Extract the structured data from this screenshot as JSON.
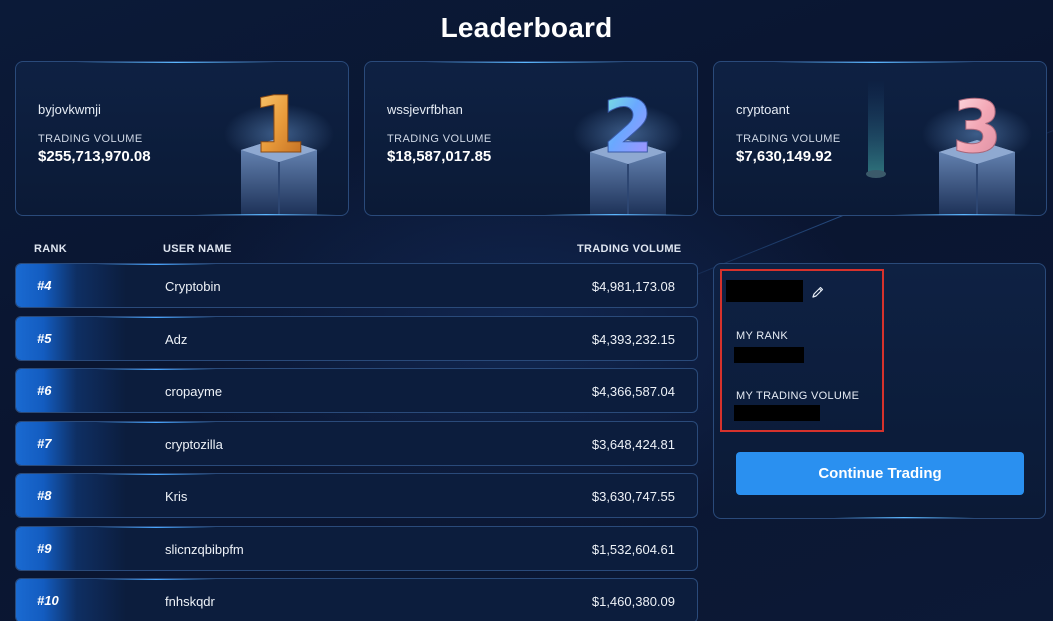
{
  "page_title": "Leaderboard",
  "podium": [
    {
      "rank_glyph": "1",
      "username": "byjovkwmji",
      "volume_label": "TRADING VOLUME",
      "volume": "$255,713,970.08"
    },
    {
      "rank_glyph": "2",
      "username": "wssjevrfbhan",
      "volume_label": "TRADING VOLUME",
      "volume": "$18,587,017.85"
    },
    {
      "rank_glyph": "3",
      "username": "cryptoant",
      "volume_label": "TRADING VOLUME",
      "volume": "$7,630,149.92"
    }
  ],
  "table": {
    "headers": {
      "rank": "RANK",
      "username": "USER NAME",
      "volume": "TRADING VOLUME"
    },
    "rows": [
      {
        "rank": "#4",
        "username": "Cryptobin",
        "volume": "$4,981,173.08"
      },
      {
        "rank": "#5",
        "username": "Adz",
        "volume": "$4,393,232.15"
      },
      {
        "rank": "#6",
        "username": "cropayme",
        "volume": "$4,366,587.04"
      },
      {
        "rank": "#7",
        "username": "cryptozilla",
        "volume": "$3,648,424.81"
      },
      {
        "rank": "#8",
        "username": "Kris",
        "volume": "$3,630,747.55"
      },
      {
        "rank": "#9",
        "username": "slicnzqbibpfm",
        "volume": "$1,532,604.61"
      },
      {
        "rank": "#10",
        "username": "fnhskqdr",
        "volume": "$1,460,380.09"
      }
    ]
  },
  "my_stats": {
    "rank_label": "MY RANK",
    "volume_label": "MY TRADING VOLUME",
    "edit_icon": "pencil-icon"
  },
  "continue_button": "Continue Trading",
  "colors": {
    "background": "#0a1630",
    "accent_blue": "#2a90f0",
    "card_border": "#2a4a7a",
    "highlight_red": "#d6322c"
  }
}
